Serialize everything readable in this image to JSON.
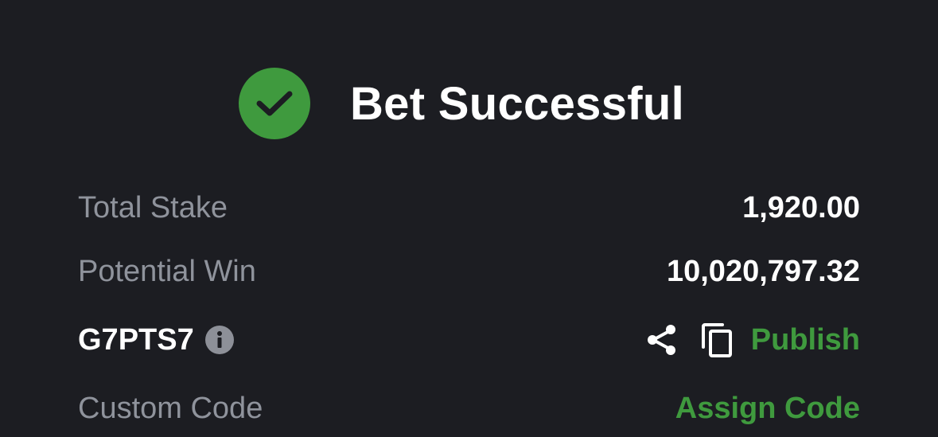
{
  "header": {
    "title": "Bet Successful",
    "status_icon": "check-circle-icon",
    "accent_color": "#3f9a3e"
  },
  "summary": {
    "total_stake_label": "Total Stake",
    "total_stake_value": "1,920.00",
    "potential_win_label": "Potential Win",
    "potential_win_value": "10,020,797.32"
  },
  "booking": {
    "code": "G7PTS7",
    "info_icon": "info-icon",
    "share_icon": "share-icon",
    "copy_icon": "copy-icon",
    "publish_label": "Publish"
  },
  "custom_code": {
    "label": "Custom Code",
    "assign_label": "Assign Code"
  }
}
